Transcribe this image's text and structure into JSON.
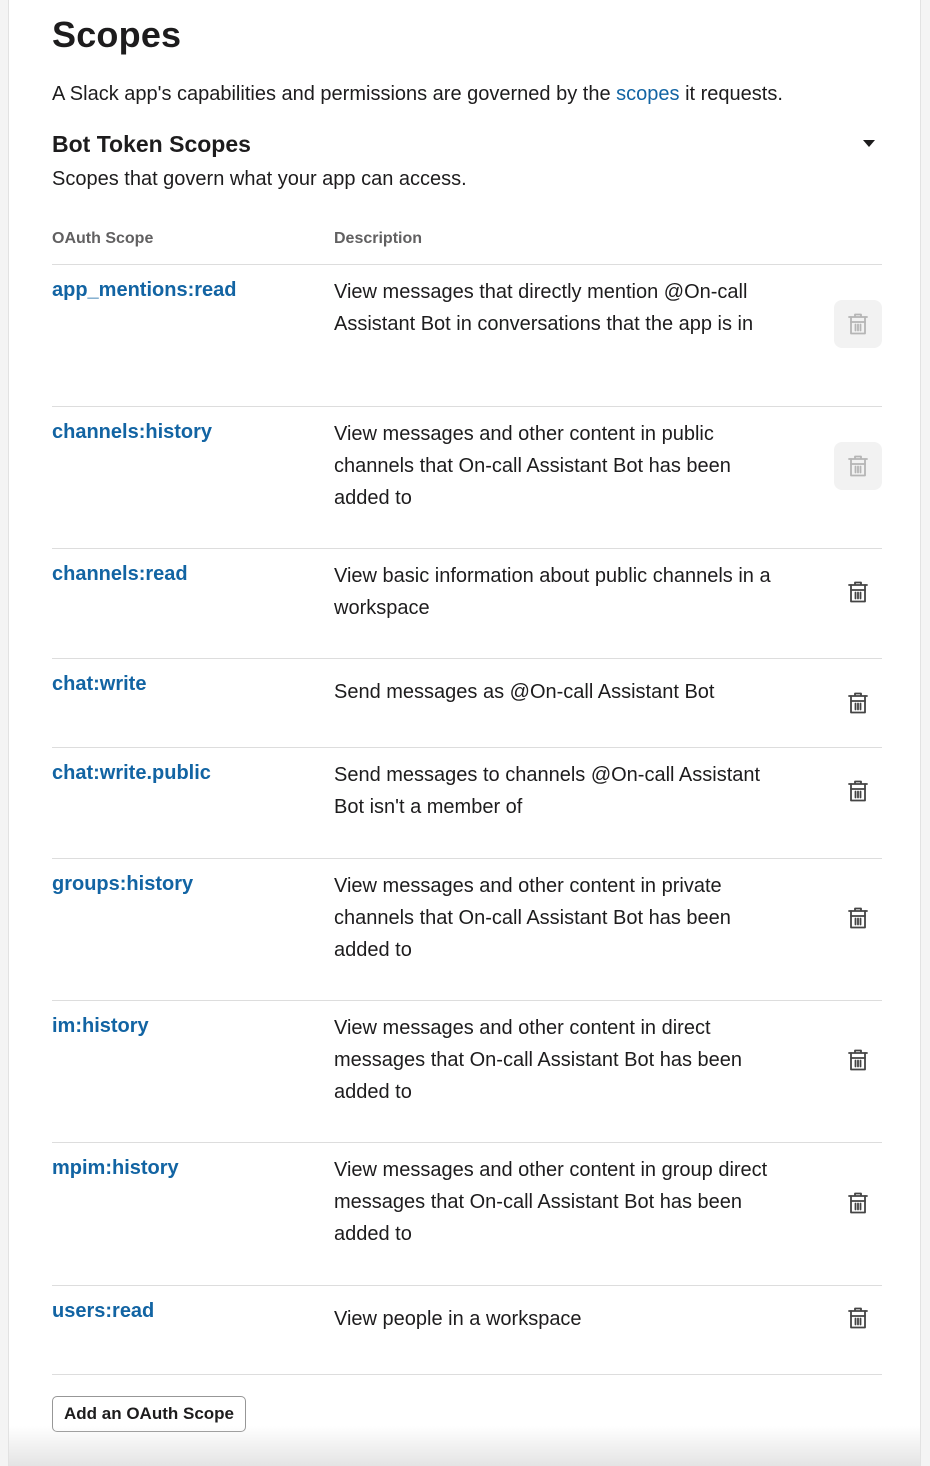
{
  "page": {
    "title": "Scopes",
    "intro_before": "A Slack app's capabilities and permissions are governed by the ",
    "intro_link": "scopes",
    "intro_after": " it requests."
  },
  "section": {
    "title": "Bot Token Scopes",
    "subtitle": "Scopes that govern what your app can access."
  },
  "table": {
    "headers": {
      "scope": "OAuth Scope",
      "description": "Description"
    },
    "rows": [
      {
        "scope": "app_mentions:read",
        "description": "View messages that directly mention @On-call Assistant Bot in conversations that the app is in",
        "delete_disabled": true
      },
      {
        "scope": "channels:history",
        "description": "View messages and other content in public channels that On-call Assistant Bot has been added to",
        "delete_disabled": true
      },
      {
        "scope": "channels:read",
        "description": "View basic information about public channels in a workspace",
        "delete_disabled": false
      },
      {
        "scope": "chat:write",
        "description": "Send messages as @On-call Assistant Bot",
        "delete_disabled": false
      },
      {
        "scope": "chat:write.public",
        "description": "Send messages to channels @On-call Assistant Bot isn't a member of",
        "delete_disabled": false
      },
      {
        "scope": "groups:history",
        "description": "View messages and other content in private channels that On-call Assistant Bot has been added to",
        "delete_disabled": false
      },
      {
        "scope": "im:history",
        "description": "View messages and other content in direct messages that On-call Assistant Bot has been added to",
        "delete_disabled": false
      },
      {
        "scope": "mpim:history",
        "description": "View messages and other content in group direct messages that On-call Assistant Bot has been added to",
        "delete_disabled": false
      },
      {
        "scope": "users:read",
        "description": "View people in a workspace",
        "delete_disabled": false
      }
    ]
  },
  "actions": {
    "add_scope": "Add an OAuth Scope"
  },
  "icons": {
    "row_action": "trash-icon",
    "section_toggle": "caret-down-icon"
  },
  "colors": {
    "link": "#1264a3",
    "text": "#1d1c1d",
    "muted": "#616061"
  }
}
